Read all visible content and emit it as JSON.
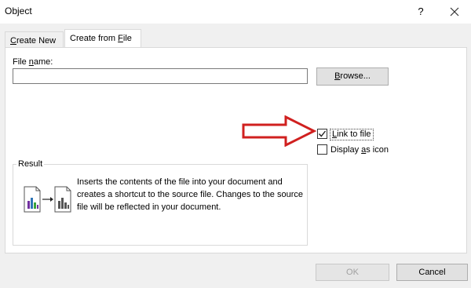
{
  "window": {
    "title": "Object",
    "help_label": "?"
  },
  "tabs": [
    {
      "label_pre": "",
      "label_key": "C",
      "label_post": "reate New"
    },
    {
      "label_pre": "Create from ",
      "label_key": "F",
      "label_post": "ile"
    }
  ],
  "file_name": {
    "label_pre": "File ",
    "label_key": "n",
    "label_post": "ame:",
    "value": ""
  },
  "browse": {
    "label_key": "B",
    "label_post": "rowse..."
  },
  "options": {
    "link_to_file": {
      "label_pre": "",
      "label_key": "L",
      "label_post": "ink to file",
      "checked": true
    },
    "display_as_icon": {
      "label_pre": "Display ",
      "label_key": "a",
      "label_post": "s icon",
      "checked": false
    }
  },
  "result": {
    "legend": "Result",
    "description": "Inserts the contents of the file into your document and creates a shortcut to the source file.  Changes to the source file will be reflected in your document."
  },
  "buttons": {
    "ok": "OK",
    "cancel": "Cancel"
  },
  "colors": {
    "arrow": "#d0201f",
    "chart_purple": "#7030a0",
    "chart_green": "#3aa53a",
    "chart_blue": "#2e75b6"
  }
}
